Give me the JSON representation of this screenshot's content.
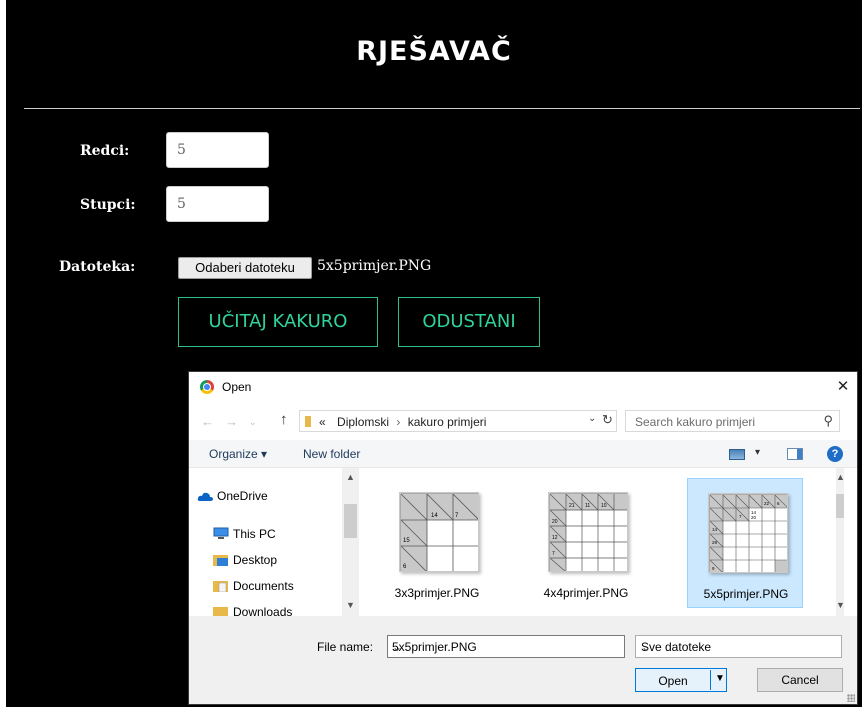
{
  "page": {
    "title": "RJEŠAVAČ",
    "rows_label": "Redci:",
    "rows_value": "5",
    "cols_label": "Stupci:",
    "cols_value": "5",
    "file_label": "Datoteka:",
    "file_button": "Odaberi datoteku",
    "file_chosen": "5x5primjer.PNG",
    "load_button": "UČITAJ KAKURO",
    "cancel_button": "ODUSTANI",
    "accent_color": "#2fd39a"
  },
  "dialog": {
    "title": "Open",
    "close_glyph": "✕",
    "breadcrumb": [
      "Diplomski",
      "kakuro primjeri"
    ],
    "breadcrumb_prefix": "«",
    "search_placeholder": "Search kakuro primjeri",
    "organize_label": "Organize ▾",
    "new_folder_label": "New folder",
    "help_glyph": "?",
    "nav_items": [
      {
        "label": "OneDrive",
        "icon": "onedrive-icon"
      },
      {
        "label": "This PC",
        "icon": "computer-icon"
      },
      {
        "label": "Desktop",
        "icon": "desktop-folder-icon"
      },
      {
        "label": "Documents",
        "icon": "documents-folder-icon"
      },
      {
        "label": "Downloads",
        "icon": "downloads-folder-icon"
      }
    ],
    "files": [
      {
        "name": "3x3primjer.PNG",
        "selected": false,
        "clues": [
          "14",
          "7",
          "15",
          "6"
        ]
      },
      {
        "name": "4x4primjer.PNG",
        "selected": false,
        "clues": [
          "21",
          "11",
          "10",
          "20",
          "12",
          "7"
        ]
      },
      {
        "name": "5x5primjer.PNG",
        "selected": true,
        "clues": [
          "22",
          "6",
          "14",
          "7",
          "20",
          "14",
          "29",
          "9"
        ]
      }
    ],
    "file_name_label": "File name:",
    "file_name_value": "5x5primjer.PNG",
    "file_type_value": "Sve datoteke",
    "open_label": "Open",
    "cancel_label": "Cancel"
  }
}
